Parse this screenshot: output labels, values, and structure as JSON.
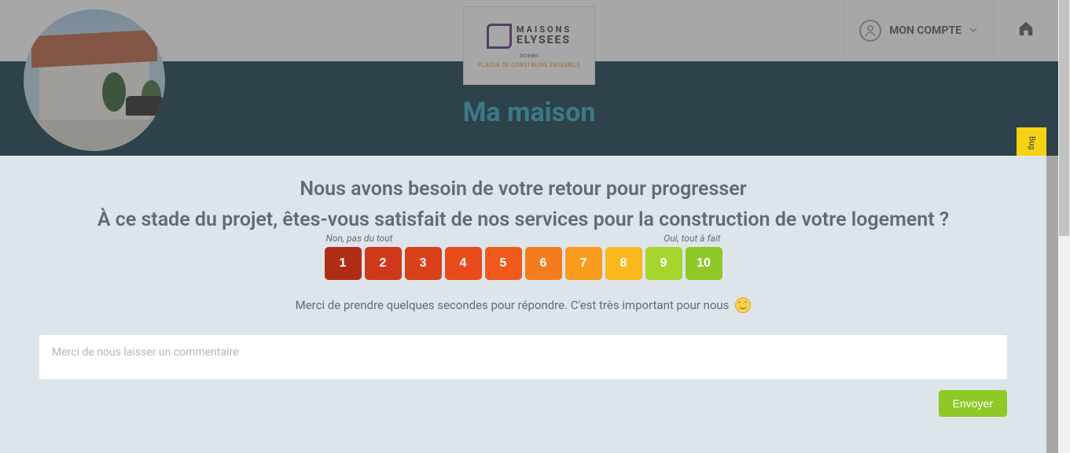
{
  "header": {
    "logo_line1": "MAISONS",
    "logo_line2": "ELYSEES",
    "logo_sub": "ocean",
    "logo_tag": "PLAISIR DE CONSTRUIRE ENSEMBLE",
    "account_label": "MON COMPTE"
  },
  "hero": {
    "title": "Ma maison"
  },
  "feedback": {
    "title1": "Nous avons besoin de votre retour pour progresser",
    "title2": "À ce stade du projet, êtes-vous satisfait de nos services pour la construction de votre logement ?",
    "label_low": "Non, pas du tout",
    "label_high": "Oui, tout à fait",
    "scale": [
      "1",
      "2",
      "3",
      "4",
      "5",
      "6",
      "7",
      "8",
      "9",
      "10"
    ],
    "help_text": "Merci de prendre quelques secondes pour répondre. C'est très important pour nous",
    "comment_placeholder": "Merci de nous laisser un commentaire",
    "send_label": "Envoyer"
  },
  "bug_tab": "Bug"
}
